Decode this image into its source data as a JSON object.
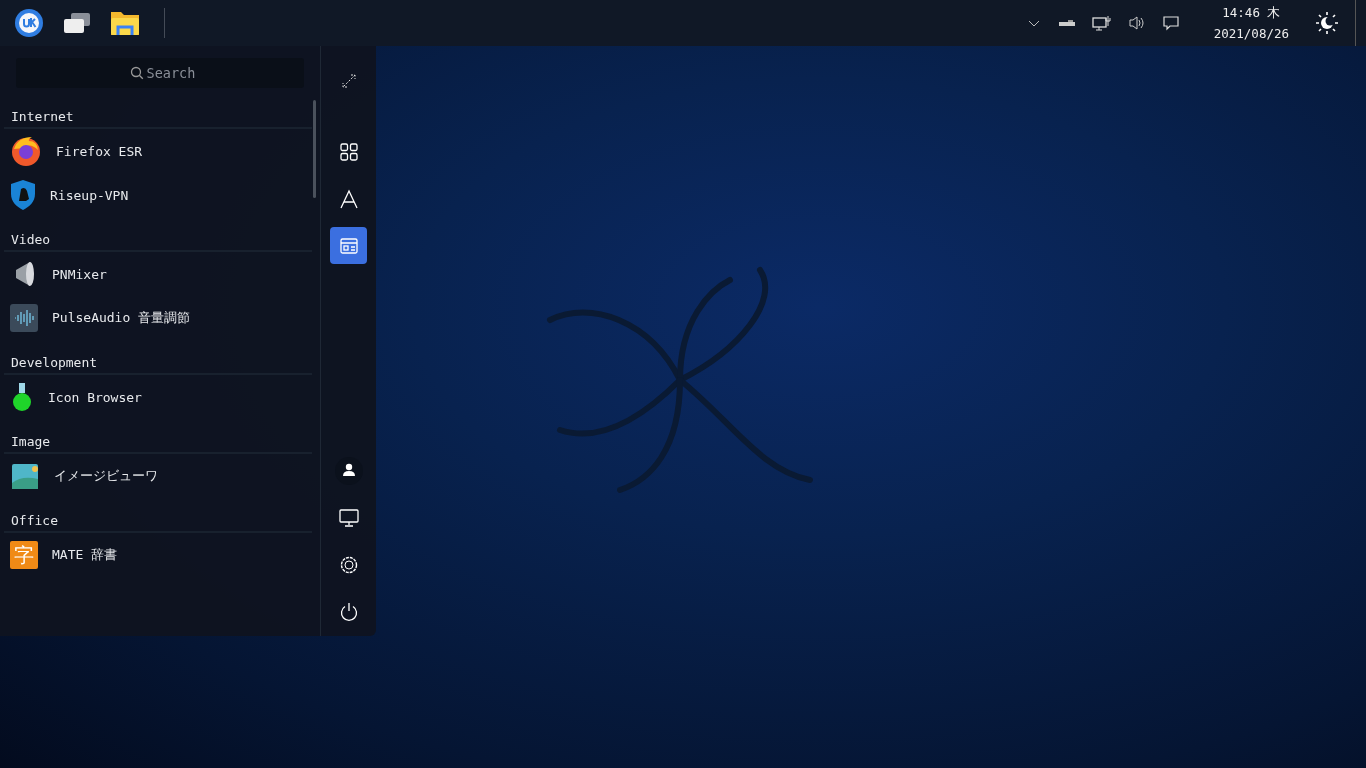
{
  "tray": {
    "time": "14:46 木",
    "date": "2021/08/26"
  },
  "menu": {
    "search": {
      "placeholder": "Search"
    },
    "categories": [
      {
        "name": "Internet",
        "apps": [
          {
            "name": "Firefox ESR",
            "kind": "firefox"
          },
          {
            "name": "Riseup-VPN",
            "kind": "vpn"
          }
        ]
      },
      {
        "name": "Video",
        "apps": [
          {
            "name": "PNMixer",
            "kind": "speaker"
          },
          {
            "name": "PulseAudio 音量調節",
            "kind": "wave"
          }
        ]
      },
      {
        "name": "Development",
        "apps": [
          {
            "name": "Icon Browser",
            "kind": "flask"
          }
        ]
      },
      {
        "name": "Image",
        "apps": [
          {
            "name": "イメージビューワ",
            "kind": "image"
          }
        ]
      },
      {
        "name": "Office",
        "apps": [
          {
            "name": "MATE 辞書",
            "kind": "dict",
            "glyph": "字"
          }
        ]
      }
    ],
    "views": [
      {
        "kind": "all",
        "selected": false
      },
      {
        "kind": "letter",
        "selected": false
      },
      {
        "kind": "category",
        "selected": true
      }
    ]
  }
}
